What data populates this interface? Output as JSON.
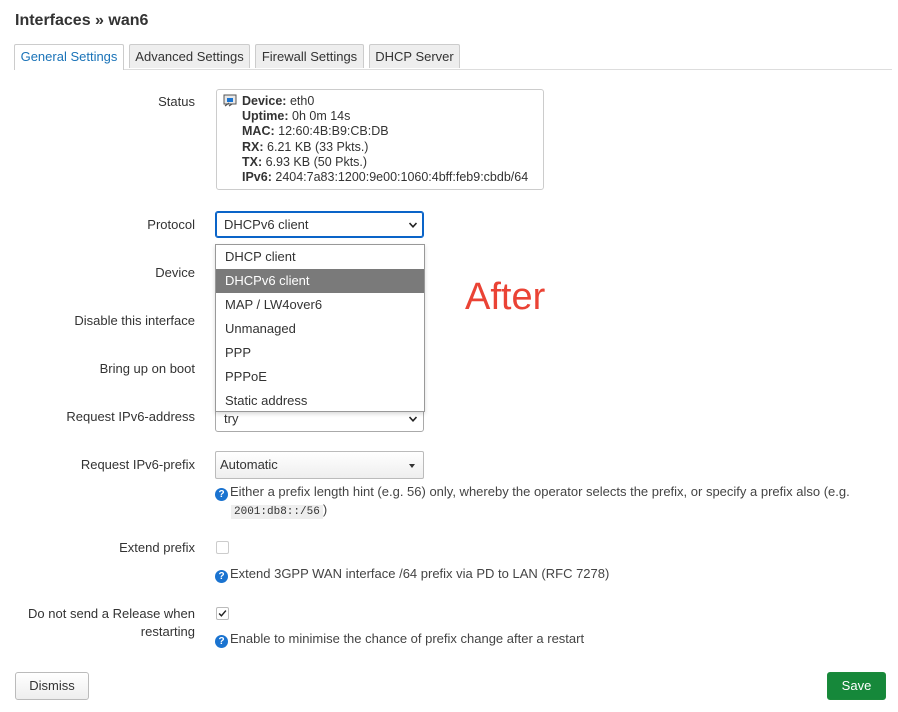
{
  "page": {
    "title": "Interfaces » wan6"
  },
  "tabs": [
    {
      "label": "General Settings",
      "active": true
    },
    {
      "label": "Advanced Settings",
      "active": false
    },
    {
      "label": "Firewall Settings",
      "active": false
    },
    {
      "label": "DHCP Server",
      "active": false
    }
  ],
  "status": {
    "label": "Status",
    "rows": [
      {
        "key": "Device:",
        "value": "eth0"
      },
      {
        "key": "Uptime:",
        "value": "0h 0m 14s"
      },
      {
        "key": "MAC:",
        "value": "12:60:4B:B9:CB:DB"
      },
      {
        "key": "RX:",
        "value": "6.21 KB (33 Pkts.)"
      },
      {
        "key": "TX:",
        "value": "6.93 KB (50 Pkts.)"
      },
      {
        "key": "IPv6:",
        "value": "2404:7a83:1200:9e00:1060:4bff:feb9:cbdb/64"
      }
    ]
  },
  "protocol": {
    "label": "Protocol",
    "value": "DHCPv6 client",
    "options": [
      "DHCP client",
      "DHCPv6 client",
      "MAP / LW4over6",
      "Unmanaged",
      "PPP",
      "PPPoE",
      "Static address"
    ],
    "selected_index": 1
  },
  "fields": {
    "device_label": "Device",
    "disable_label": "Disable this interface",
    "bringup_label": "Bring up on boot",
    "req_addr_label": "Request IPv6-address",
    "req_addr_value": "try",
    "req_prefix_label": "Request IPv6-prefix",
    "req_prefix_value": "Automatic",
    "req_prefix_hint_pre": "Either a prefix length hint (e.g. 56) only, whereby the operator selects the prefix, or specify a prefix also (e.g.",
    "req_prefix_hint_code": "2001:db8::/56",
    "req_prefix_hint_post": ")",
    "extend_label": "Extend prefix",
    "extend_checked": false,
    "extend_hint": "Extend 3GPP WAN interface /64 prefix via PD to LAN (RFC 7278)",
    "norelease_label_1": "Do not send a Release when",
    "norelease_label_2": "restarting",
    "norelease_checked": true,
    "norelease_hint": "Enable to minimise the chance of prefix change after a restart"
  },
  "annotation": {
    "text": "After",
    "color": "#ea4335"
  },
  "buttons": {
    "dismiss": "Dismiss",
    "save": "Save"
  },
  "colors": {
    "accent": "#1a73b8",
    "save": "#16883a",
    "selected_option": "#7a7a7a",
    "help_icon": "#1a73d0"
  },
  "icons": {
    "status": "network-port-icon",
    "help": "question-circle-icon",
    "select": "chevron-down-icon"
  }
}
